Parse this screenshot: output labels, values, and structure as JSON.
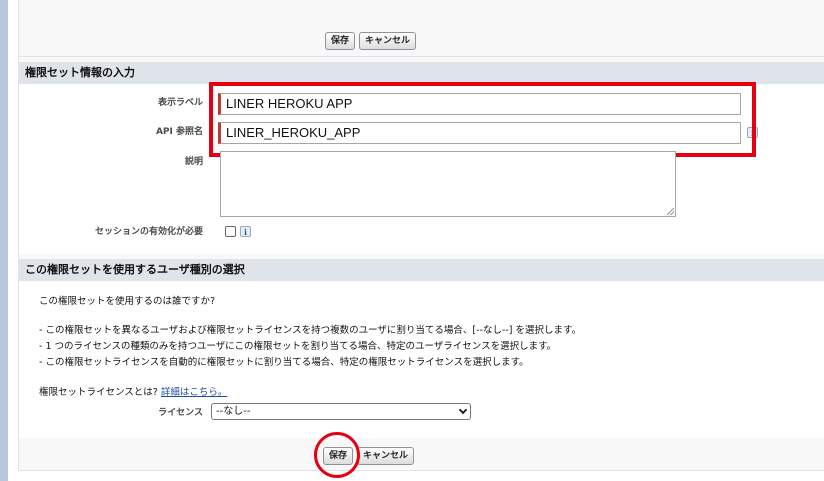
{
  "buttons": {
    "save": "保存",
    "cancel": "キャンセル"
  },
  "section1": {
    "title": "権限セット情報の入力",
    "label_field": {
      "label": "表示ラベル",
      "value": "LINER HEROKU APP"
    },
    "api_field": {
      "label": "API 参照名",
      "value": "LINER_HEROKU_APP"
    },
    "description": {
      "label": "説明",
      "value": ""
    },
    "session": {
      "label": "セッションの有効化が必要",
      "checked": false
    }
  },
  "section2": {
    "title": "この権限セットを使用するユーザ種別の選択",
    "question": "この権限セットを使用するのは誰ですか?",
    "bullets": [
      "- この権限セットを異なるユーザおよび権限セットライセンスを持つ複数のユーザに割り当てる場合、[--なし--] を選択します。",
      "- 1 つのライセンスの種類のみを持つユーザにこの権限セットを割り当てる場合、特定のユーザライセンスを選択します。",
      "- この権限セットライセンスを自動的に権限セットに割り当てる場合、特定の権限セットライセンスを選択します。"
    ],
    "license_question": "権限セットライセンスとは?",
    "details_link": "詳細はこちら。",
    "license_label": "ライセンス",
    "license_value": "--なし--"
  },
  "icons": {
    "info": "info-icon",
    "dropdown": "chevron-down-icon"
  },
  "colors": {
    "highlight": "#e60012",
    "required": "#c23934",
    "section_header": "#dfe3ea"
  }
}
